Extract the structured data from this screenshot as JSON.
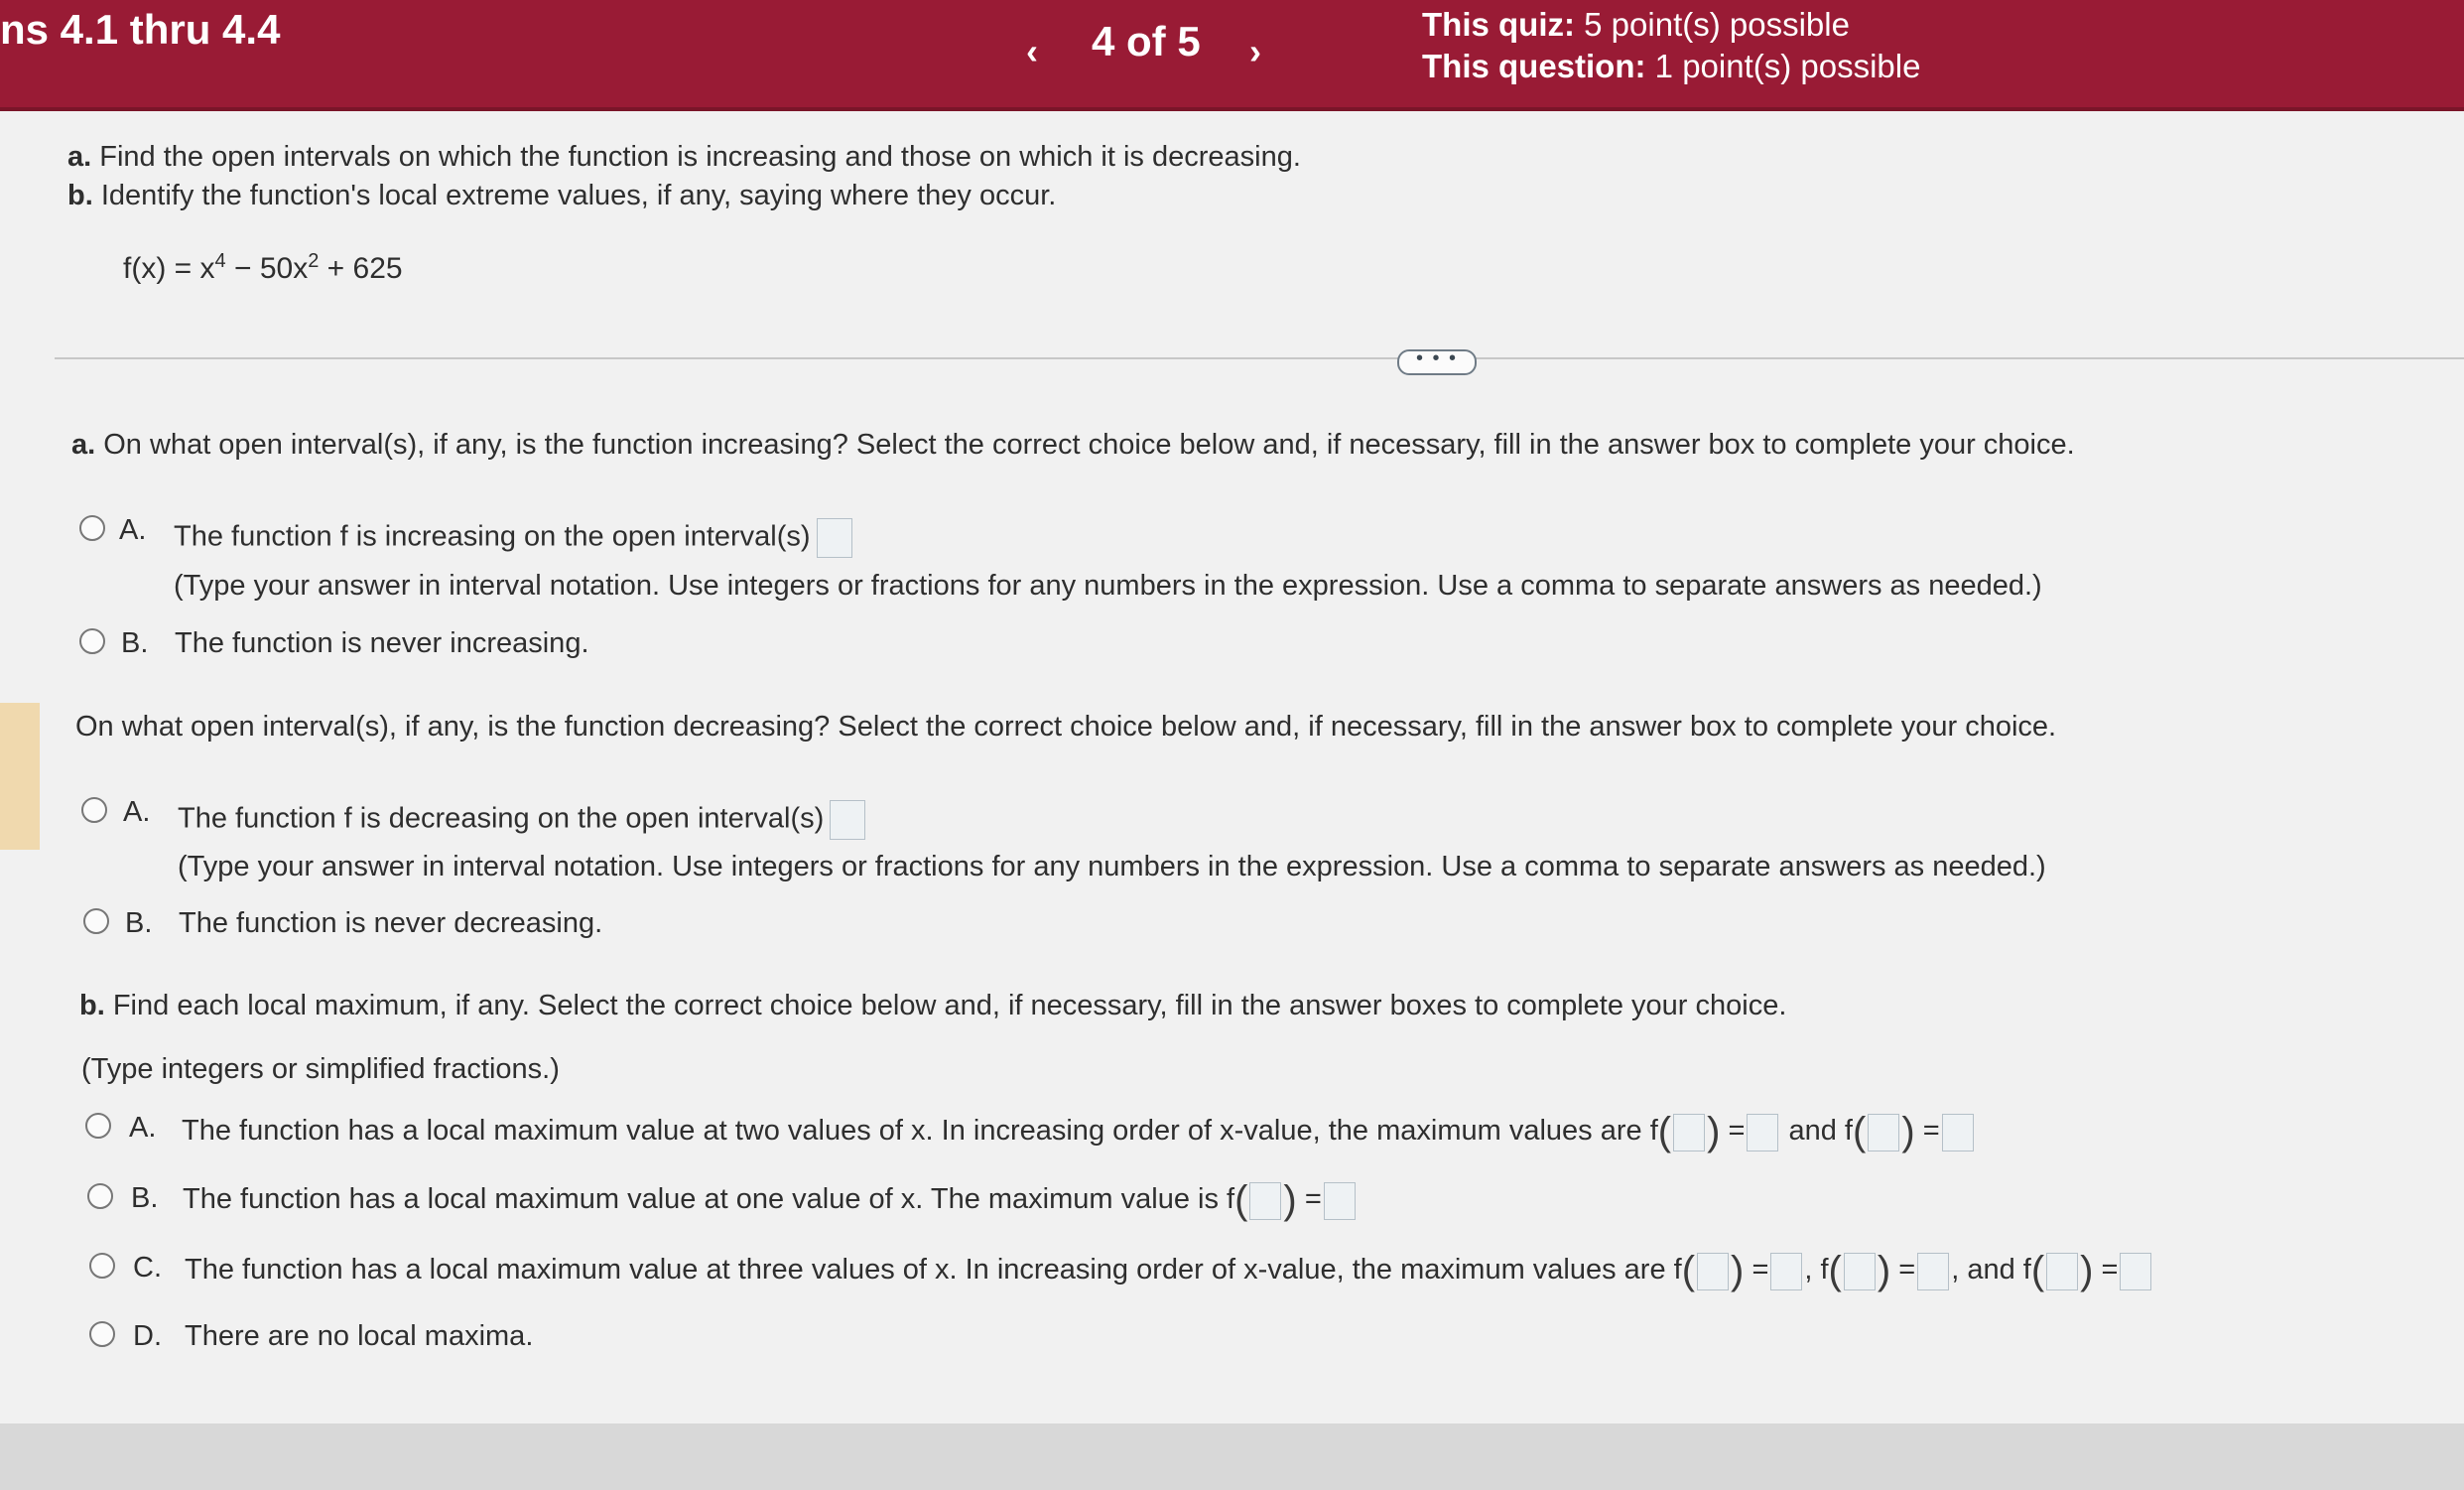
{
  "header": {
    "title": "ns 4.1 thru 4.4",
    "prev": "‹",
    "next": "›",
    "pager": "4 of 5",
    "quiz_label": "This quiz:",
    "quiz_value": "5 point(s) possible",
    "question_label": "This question:",
    "question_value": "1 point(s) possible"
  },
  "problem": {
    "a_label": "a.",
    "a_text": "Find the open intervals on which the function is increasing and those on which it is decreasing.",
    "b_label": "b.",
    "b_text": "Identify the function's local extreme values, if any, saying where they occur.",
    "function": {
      "lhs": "f(x) = x",
      "exp1": "4",
      "mid": " − 50x",
      "exp2": "2",
      "tail": " + 625"
    },
    "more_button": "• • •"
  },
  "part_a": {
    "label": "a.",
    "increasing_question": "On what open interval(s), if any, is the function increasing? Select the correct choice below and, if necessary, fill in the answer box to complete your choice.",
    "inc_A_letter": "A.",
    "inc_A_text": "The function f is increasing on the open interval(s)",
    "inc_A_hint": "(Type your answer in interval notation. Use integers or fractions for any numbers in the expression. Use a comma to separate answers as needed.)",
    "inc_B_letter": "B.",
    "inc_B_text": "The function is never increasing.",
    "decreasing_question": "On what open interval(s), if any, is the function decreasing? Select the correct choice below and, if necessary, fill in the answer box to complete your choice.",
    "dec_A_letter": "A.",
    "dec_A_text": "The function f is decreasing on the open interval(s)",
    "dec_A_hint": "(Type your answer in interval notation. Use integers or fractions for any numbers in the expression. Use a comma to separate answers as needed.)",
    "dec_B_letter": "B.",
    "dec_B_text": "The function is never decreasing."
  },
  "part_b": {
    "label": "b.",
    "question": "Find each local maximum, if any. Select the correct choice below and, if necessary, fill in the answer boxes to complete your choice.",
    "hint": "(Type integers or simplified fractions.)",
    "A_letter": "A.",
    "A_text": "The function has a local maximum value at two values of x. In increasing order of x-value, the maximum values are",
    "B_letter": "B.",
    "B_text": "The function has a local maximum value at one value of x. The maximum value is",
    "C_letter": "C.",
    "C_text": "The function has a local maximum value at three values of x. In increasing order of x-value, the maximum values are",
    "D_letter": "D.",
    "D_text": "There are no local maxima.",
    "f_label": "f",
    "equals": "=",
    "and_word": "and",
    "comma_f": ", f",
    "comma_and_f": ", and f"
  }
}
